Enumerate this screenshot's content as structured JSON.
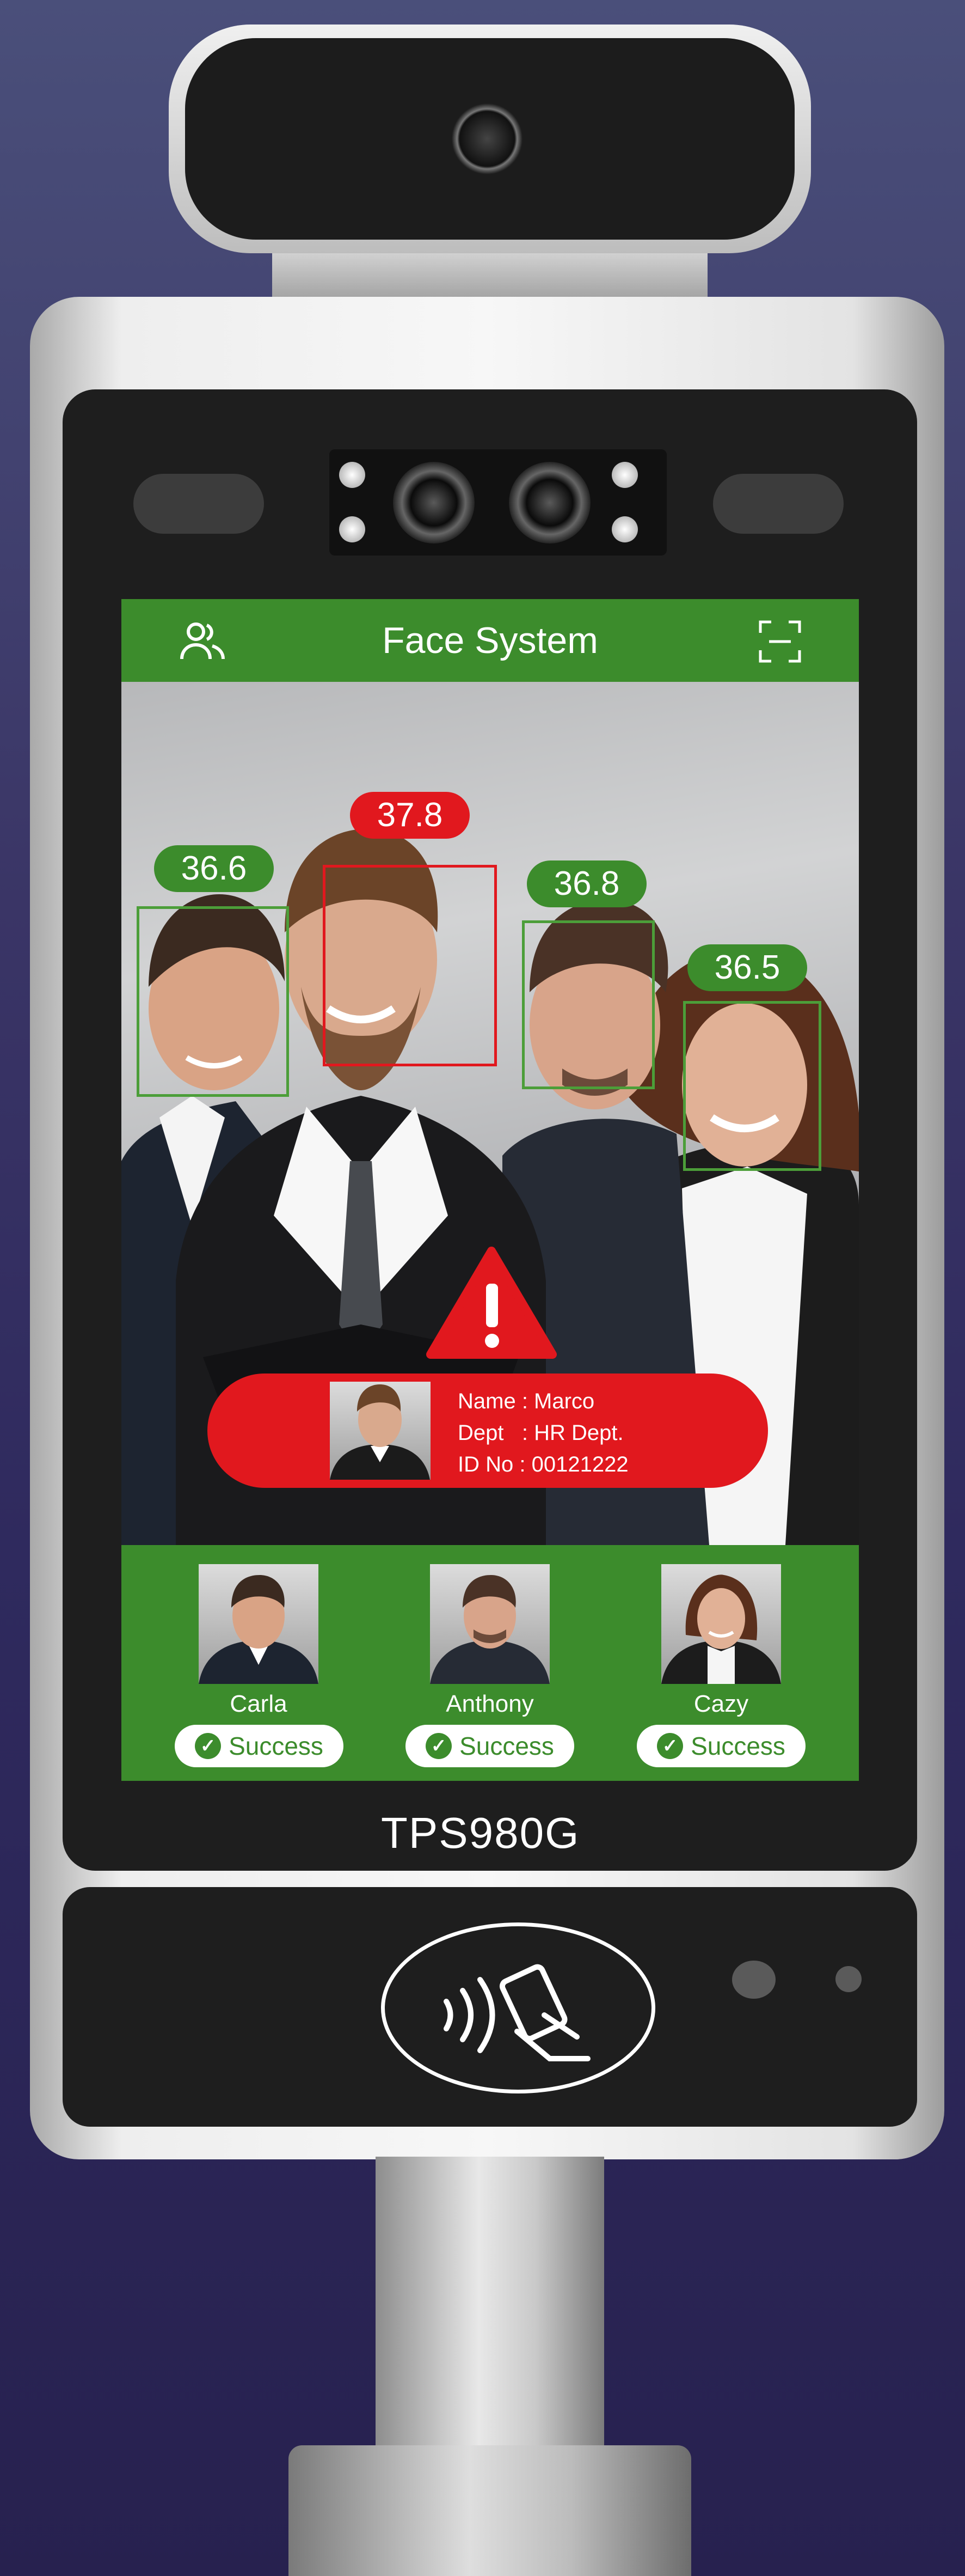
{
  "header": {
    "title": "Face System",
    "users_icon": "users-icon",
    "scan_icon": "scan-frame-icon"
  },
  "temperatures": [
    {
      "value": "36.6",
      "status": "normal"
    },
    {
      "value": "37.8",
      "status": "alert"
    },
    {
      "value": "36.8",
      "status": "normal"
    },
    {
      "value": "36.5",
      "status": "normal"
    }
  ],
  "alert": {
    "icon": "warning-icon",
    "name_label": "Name",
    "name_value": "Marco",
    "dept_label": "Dept",
    "dept_value": "HR Dept.",
    "id_label": "ID No",
    "id_value": "00121222"
  },
  "recognized": [
    {
      "name": "Carla",
      "status": "Success"
    },
    {
      "name": "Anthony",
      "status": "Success"
    },
    {
      "name": "Cazy",
      "status": "Success"
    }
  ],
  "device": {
    "model": "TPS980G",
    "nfc_icon": "nfc-card-icon"
  },
  "colors": {
    "accent_green": "#3c8c2c",
    "alert_red": "#e1181e"
  }
}
